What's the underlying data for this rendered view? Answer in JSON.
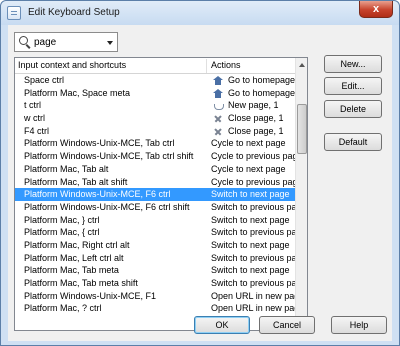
{
  "window": {
    "title": "Edit Keyboard Setup",
    "close_glyph": "x"
  },
  "search": {
    "value": "page"
  },
  "table": {
    "headers": {
      "context": "Input context and shortcuts",
      "actions": "Actions"
    },
    "rows": [
      {
        "context": "Space ctrl",
        "action": "Go to homepage",
        "icon": "home-icon"
      },
      {
        "context": "Platform Mac, Space meta",
        "action": "Go to homepage",
        "icon": "home-icon"
      },
      {
        "context": "t ctrl",
        "action": "New page, 1",
        "icon": "new-page-icon"
      },
      {
        "context": "w ctrl",
        "action": "Close page, 1",
        "icon": "close-icon"
      },
      {
        "context": "F4 ctrl",
        "action": "Close page, 1",
        "icon": "close-icon"
      },
      {
        "context": "Platform Windows-Unix-MCE, Tab ctrl",
        "action": "Cycle to next page",
        "icon": ""
      },
      {
        "context": "Platform Windows-Unix-MCE, Tab ctrl shift",
        "action": "Cycle to previous page",
        "icon": ""
      },
      {
        "context": "Platform Mac, Tab alt",
        "action": "Cycle to next page",
        "icon": ""
      },
      {
        "context": "Platform Mac, Tab alt shift",
        "action": "Cycle to previous page",
        "icon": ""
      },
      {
        "context": "Platform Windows-Unix-MCE, F6 ctrl",
        "action": "Switch to next page",
        "icon": "",
        "selected": true
      },
      {
        "context": "Platform Windows-Unix-MCE, F6 ctrl shift",
        "action": "Switch to previous page",
        "icon": ""
      },
      {
        "context": "Platform Mac, } ctrl",
        "action": "Switch to next page",
        "icon": ""
      },
      {
        "context": "Platform Mac, { ctrl",
        "action": "Switch to previous page",
        "icon": ""
      },
      {
        "context": "Platform Mac, Right ctrl alt",
        "action": "Switch to next page",
        "icon": ""
      },
      {
        "context": "Platform Mac, Left ctrl alt",
        "action": "Switch to previous page",
        "icon": ""
      },
      {
        "context": "Platform Mac, Tab meta",
        "action": "Switch to next page",
        "icon": ""
      },
      {
        "context": "Platform Mac, Tab meta shift",
        "action": "Switch to previous page",
        "icon": ""
      },
      {
        "context": "Platform Windows-Unix-MCE, F1",
        "action": "Open URL in new page",
        "icon": ""
      },
      {
        "context": "Platform Mac, ? ctrl",
        "action": "Open URL in new page",
        "icon": ""
      }
    ]
  },
  "buttons": {
    "new": "New...",
    "edit": "Edit...",
    "delete": "Delete",
    "default": "Default",
    "ok": "OK",
    "cancel": "Cancel",
    "help": "Help"
  },
  "colors": {
    "selection": "#3399ff",
    "frame": "#cfe0f3",
    "close": "#c7432c"
  }
}
